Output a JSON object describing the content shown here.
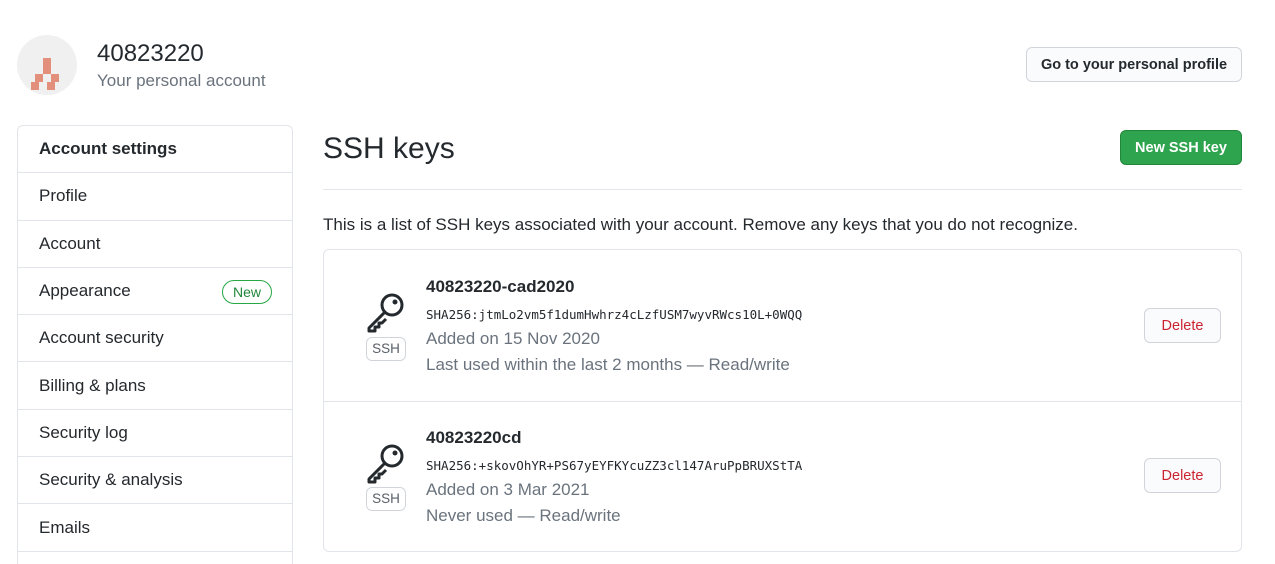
{
  "account": {
    "username": "40823220",
    "subtitle": "Your personal account",
    "profile_button": "Go to your personal profile"
  },
  "sidebar": {
    "heading": "Account settings",
    "items": [
      {
        "label": "Profile"
      },
      {
        "label": "Account"
      },
      {
        "label": "Appearance",
        "badge": "New"
      },
      {
        "label": "Account security"
      },
      {
        "label": "Billing & plans"
      },
      {
        "label": "Security log"
      },
      {
        "label": "Security & analysis"
      },
      {
        "label": "Emails"
      }
    ]
  },
  "main": {
    "title": "SSH keys",
    "new_button": "New SSH key",
    "intro": "This is a list of SSH keys associated with your account. Remove any keys that you do not recognize."
  },
  "keys": [
    {
      "title": "40823220-cad2020",
      "fingerprint": "SHA256:jtmLo2vm5f1dumHwhrz4cLzfUSM7wyvRWcs10L+0WQQ",
      "added": "Added on 15 Nov 2020",
      "usage": "Last used within the last 2 months — Read/write",
      "type_label": "SSH",
      "delete_label": "Delete"
    },
    {
      "title": "40823220cd",
      "fingerprint": "SHA256:+skovOhYR+PS67yEYFKYcuZZ3cl147AruPpBRUXStTA",
      "added": "Added on 3 Mar 2021",
      "usage": "Never used — Read/write",
      "type_label": "SSH",
      "delete_label": "Delete"
    }
  ],
  "icons": {
    "avatar": "identicon-avatar",
    "key": "key-icon"
  },
  "colors": {
    "primary_green": "#2ea44f",
    "danger_red": "#cb2431",
    "badge_green": "#22863a",
    "avatar_pink": "#e2907b",
    "border": "#e1e4e8",
    "muted_text": "#6a737d"
  }
}
